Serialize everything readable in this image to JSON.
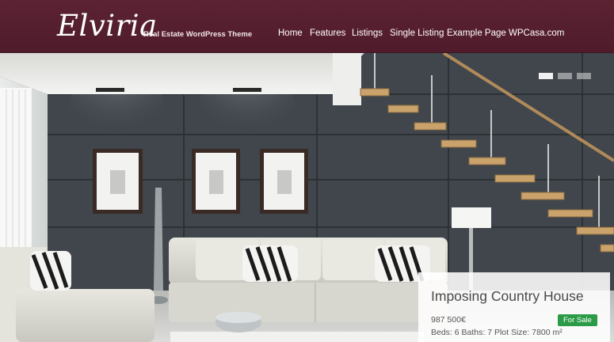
{
  "site": {
    "name": "Elviria",
    "tagline": "Real Estate WordPress Theme"
  },
  "nav": {
    "items": [
      {
        "label": "Home"
      },
      {
        "label": "Features"
      },
      {
        "label": "Listings"
      },
      {
        "label": "Single Listing"
      },
      {
        "label": "Example Page"
      },
      {
        "label": "WPCasa.com"
      }
    ]
  },
  "slider": {
    "slide_count": 3,
    "active_slide": 1,
    "image": "living-room-photo"
  },
  "listing": {
    "title": "Imposing Country House",
    "price": "987 500€",
    "details": "Beds: 6 Baths: 7 Plot Size: 7800 m²",
    "status": "For Sale"
  },
  "colors": {
    "header": "#5c2233",
    "badge": "#2c9b48"
  }
}
